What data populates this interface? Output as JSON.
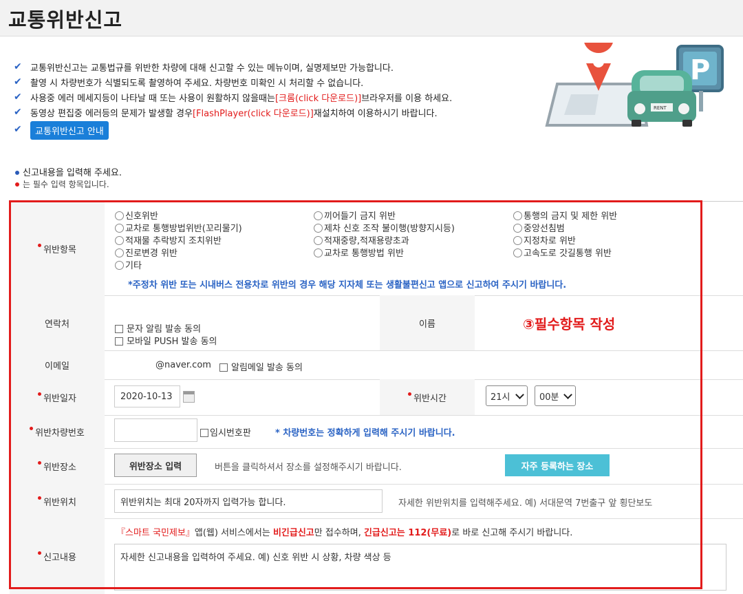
{
  "page": {
    "title": "교통위반신고"
  },
  "notice": {
    "items": [
      {
        "text": "교통위반신고는 교통법규를 위반한 차량에 대해 신고할 수 있는 메뉴이며, 실명제보만 가능합니다."
      },
      {
        "text": "촬영 시 차량번호가 식별되도록 촬영하여 주세요. 차량번호 미확인 시 처리할 수 없습니다."
      },
      {
        "pre": "사용중 에러 메세지등이 나타날 때 또는 사용이 원활하지 않을때는 ",
        "link": "[크롬(click 다운로드)]",
        "post": "브라우저를 이용 하세요."
      },
      {
        "pre": "동영상 편집중 에러등의 문제가 발생할 경우 ",
        "link": "[FlashPlayer(click 다운로드)]",
        "post": "재설치하여 이용하시기 바랍니다."
      }
    ],
    "guide_button": "교통위반신고 안내"
  },
  "intro": {
    "line1": "신고내용을 입력해 주세요.",
    "line2": "는 필수 입력 항목입니다."
  },
  "form": {
    "violation": {
      "label": "위반항목",
      "col1": [
        "신호위반",
        "교차로 통행방법위반(꼬리물기)",
        "적재물 추락방지 조치위반",
        "진로변경 위반",
        "기타"
      ],
      "col2": [
        "끼어들기 금지 위반",
        "제차 신호 조작 불이행(방향지시등)",
        "적재중량,적재용량초과",
        "교차로 통행방법 위반"
      ],
      "col3": [
        "통행의 금지 및 제한 위반",
        "중앙선침범",
        "지정차로 위반",
        "고속도로 갓길통행 위반"
      ],
      "note": "*주정차 위반 또는 시내버스 전용차로 위반의 경우 해당 지자체 또는 생활불편신고 앱으로 신고하여 주시기 바랍니다."
    },
    "contact": {
      "label": "연락처",
      "sms_consent": "문자 알림 발송 동의",
      "push_consent": "모바일 PUSH 발송 동의",
      "name_label": "이름"
    },
    "email": {
      "label": "이메일",
      "domain": "@naver.com",
      "consent": "알림메일 발송 동의"
    },
    "date": {
      "label": "위반일자",
      "value": "2020-10-13",
      "time_label": "위반시간",
      "hour": "21시",
      "minute": "00분"
    },
    "plate": {
      "label": "위반차량번호",
      "temp_plate": "임시번호판",
      "note": "* 차량번호는 정확하게 입력해 주시기 바랍니다."
    },
    "place": {
      "label": "위반장소",
      "button": "위반장소 입력",
      "hint": "버튼을 클릭하셔서 장소를 설정해주시기 바랍니다.",
      "favorite_button": "자주 등록하는 장소"
    },
    "location": {
      "label": "위반위치",
      "placeholder": "위반위치는 최대 20자까지 입력가능 합니다.",
      "hint": "자세한 위반위치를 입력해주세요. 예) 서대문역 7번출구 앞 횡단보도"
    },
    "content": {
      "label": "신고내용",
      "notice_app": "『스마트 국민제보』",
      "notice_mid1": "앱(웹) 서비스에서는 ",
      "notice_nonurgent": "비긴급신고",
      "notice_mid2": "만 접수하며, ",
      "notice_urgent": "긴급신고는 112(무료)",
      "notice_end": "로 바로 신고해 주시기 바랍니다.",
      "placeholder": "자세한 신고내용을 입력하여 주세요. 예) 신호 위반 시 상황, 차량 색상 등"
    }
  },
  "annotation": {
    "text": "③필수항목 작성"
  },
  "colors": {
    "accent_red": "#e21b1b",
    "link_blue": "#2a63c4",
    "teal": "#4cc0d6",
    "button_blue": "#1a7fd9"
  }
}
